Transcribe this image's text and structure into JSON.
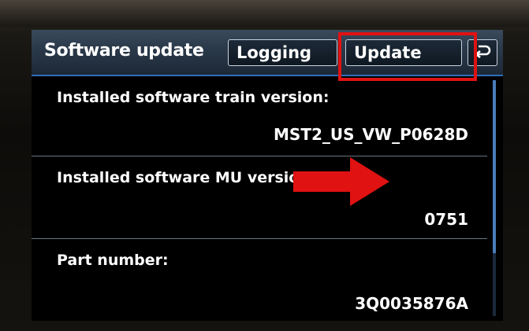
{
  "header": {
    "title": "Software update",
    "logging_label": "Logging",
    "update_label": "Update",
    "back_icon": "back-arrow-icon"
  },
  "rows": [
    {
      "label": "Installed software train version:",
      "value": "MST2_US_VW_P0628D"
    },
    {
      "label": "Installed software MU version:",
      "value": "0751"
    },
    {
      "label": "Part number:",
      "value": "3Q0035876A"
    }
  ],
  "colors": {
    "highlight": "#e01212",
    "header_accent": "#2d6fb8",
    "screen_bg": "#000000"
  }
}
